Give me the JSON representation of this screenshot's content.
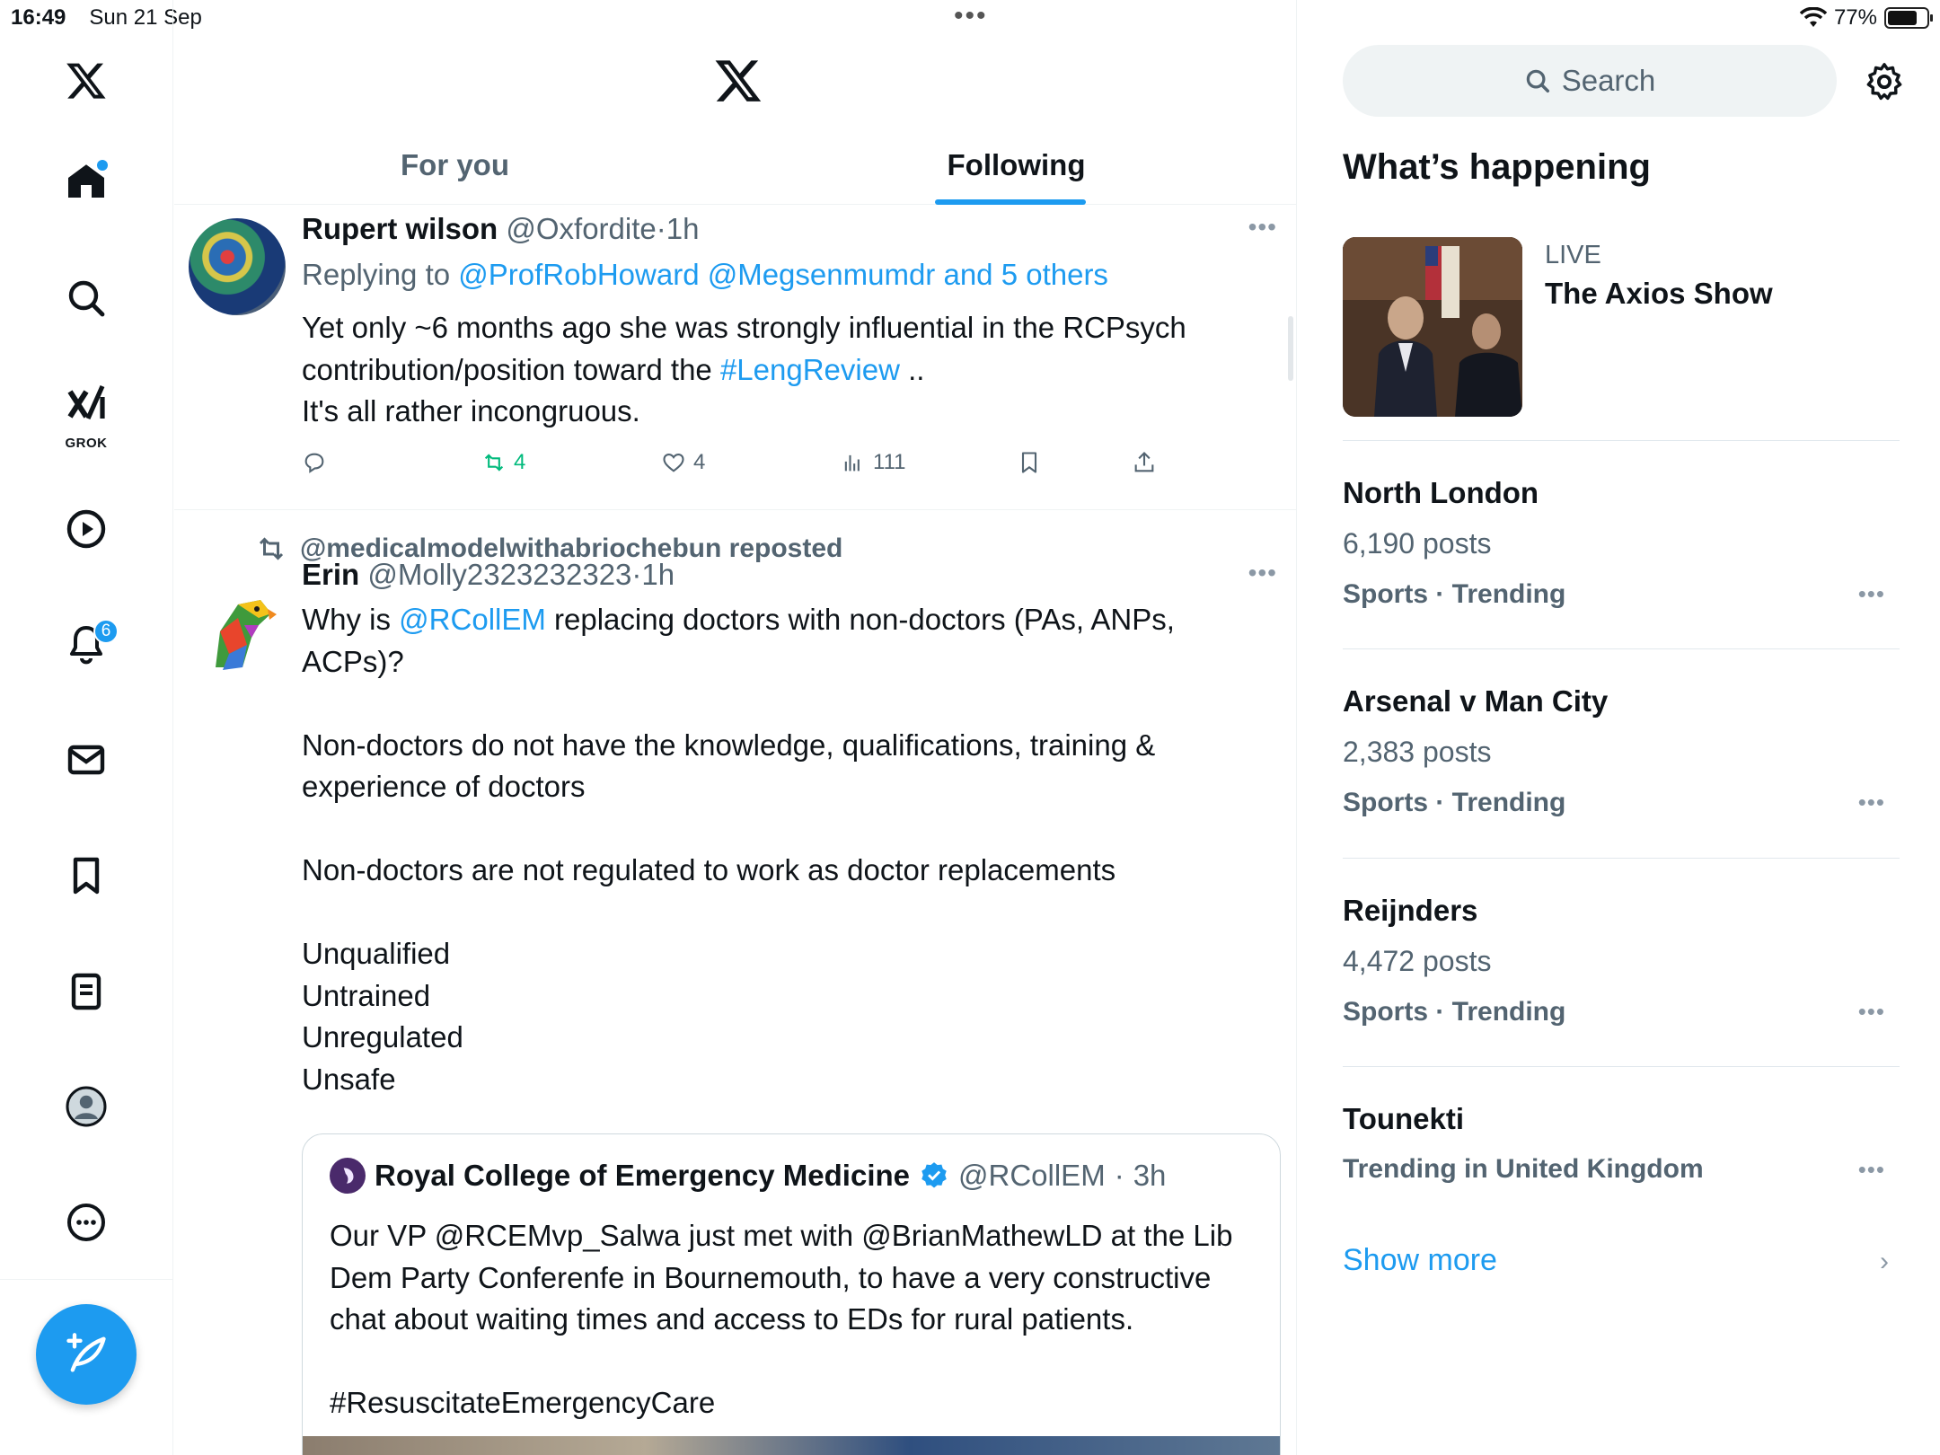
{
  "status_bar": {
    "time": "16:49",
    "date": "Sun 21 Sep",
    "battery": "77%",
    "battery_level": 0.77
  },
  "nav": {
    "notification_count": "6",
    "grok_label": "GROK",
    "icons": [
      "x-logo-icon",
      "home-icon",
      "search-icon",
      "grok-icon",
      "video-icon",
      "bell-icon",
      "mail-icon",
      "bookmark-icon",
      "lists-icon",
      "profile-icon",
      "more-icon",
      "compose-icon"
    ]
  },
  "tabs": [
    {
      "label": "For you",
      "active": false
    },
    {
      "label": "Following",
      "active": true
    }
  ],
  "tweet1": {
    "name": "Rupert wilson",
    "handle": "@Oxfordite",
    "time": "1h",
    "replying_prefix": "Replying to",
    "replying_to": "@ProfRobHoward @Megsenmumdr and 5 others",
    "text_a": "Yet only ~6 months ago she was strongly influential in the RCPsych contribution/position toward the ",
    "hashtag": "#LengReview",
    "text_b": " ..\nIt's all rather incongruous.",
    "retweets": "4",
    "likes": "4",
    "views": "111"
  },
  "tweet2": {
    "reposted_by": "@medicalmodelwithabriochebun reposted",
    "name": "Erin",
    "handle": "@Molly2323232323",
    "time": "1h",
    "text_a": "Why is ",
    "mention": "@RCollEM",
    "text_b": " replacing doctors with non-doctors (PAs, ANPs, ACPs)?\n\nNon-doctors do not have the knowledge, qualifications, training & experience of doctors\n\nNon-doctors are not regulated to work as doctor replacements\n\nUnqualified\nUntrained\nUnregulated\nUnsafe"
  },
  "quote": {
    "name": "Royal College of Emergency Medicine",
    "handle": "@RCollEM",
    "time": "3h",
    "text": "Our VP @RCEMvp_Salwa just met with @BrianMathewLD at the Lib Dem Party Conferenfe in Bournemouth, to have a very constructive chat about waiting times and access to EDs for rural patients.\n\n#ResuscitateEmergencyCare"
  },
  "sidebar": {
    "search_placeholder": "Search",
    "title": "What’s happening",
    "live": {
      "label": "LIVE",
      "title": "The Axios Show"
    },
    "trends": [
      {
        "name": "North London",
        "posts": "6,190 posts",
        "category": "Sports · Trending"
      },
      {
        "name": "Arsenal v Man City",
        "posts": "2,383 posts",
        "category": "Sports · Trending"
      },
      {
        "name": "Reijnders",
        "posts": "4,472 posts",
        "category": "Sports · Trending"
      },
      {
        "name": "Tounekti",
        "posts": "",
        "category": "Trending in United Kingdom"
      }
    ],
    "show_more": "Show more"
  },
  "colors": {
    "accent": "#1d9bf0",
    "retweet": "#00ba7c",
    "muted": "#536471",
    "text": "#0f1419"
  }
}
